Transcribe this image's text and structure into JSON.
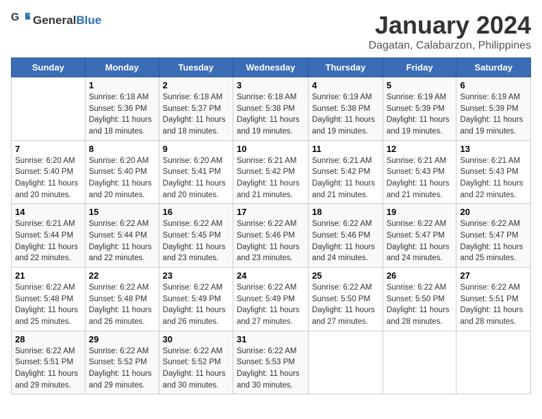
{
  "logo": {
    "general": "General",
    "blue": "Blue"
  },
  "title": "January 2024",
  "subtitle": "Dagatan, Calabarzon, Philippines",
  "days_of_week": [
    "Sunday",
    "Monday",
    "Tuesday",
    "Wednesday",
    "Thursday",
    "Friday",
    "Saturday"
  ],
  "weeks": [
    [
      {
        "day": "",
        "info": ""
      },
      {
        "day": "1",
        "info": "Sunrise: 6:18 AM\nSunset: 5:36 PM\nDaylight: 11 hours\nand 18 minutes."
      },
      {
        "day": "2",
        "info": "Sunrise: 6:18 AM\nSunset: 5:37 PM\nDaylight: 11 hours\nand 18 minutes."
      },
      {
        "day": "3",
        "info": "Sunrise: 6:18 AM\nSunset: 5:38 PM\nDaylight: 11 hours\nand 19 minutes."
      },
      {
        "day": "4",
        "info": "Sunrise: 6:19 AM\nSunset: 5:38 PM\nDaylight: 11 hours\nand 19 minutes."
      },
      {
        "day": "5",
        "info": "Sunrise: 6:19 AM\nSunset: 5:39 PM\nDaylight: 11 hours\nand 19 minutes."
      },
      {
        "day": "6",
        "info": "Sunrise: 6:19 AM\nSunset: 5:39 PM\nDaylight: 11 hours\nand 19 minutes."
      }
    ],
    [
      {
        "day": "7",
        "info": "Sunrise: 6:20 AM\nSunset: 5:40 PM\nDaylight: 11 hours\nand 20 minutes."
      },
      {
        "day": "8",
        "info": "Sunrise: 6:20 AM\nSunset: 5:40 PM\nDaylight: 11 hours\nand 20 minutes."
      },
      {
        "day": "9",
        "info": "Sunrise: 6:20 AM\nSunset: 5:41 PM\nDaylight: 11 hours\nand 20 minutes."
      },
      {
        "day": "10",
        "info": "Sunrise: 6:21 AM\nSunset: 5:42 PM\nDaylight: 11 hours\nand 21 minutes."
      },
      {
        "day": "11",
        "info": "Sunrise: 6:21 AM\nSunset: 5:42 PM\nDaylight: 11 hours\nand 21 minutes."
      },
      {
        "day": "12",
        "info": "Sunrise: 6:21 AM\nSunset: 5:43 PM\nDaylight: 11 hours\nand 21 minutes."
      },
      {
        "day": "13",
        "info": "Sunrise: 6:21 AM\nSunset: 5:43 PM\nDaylight: 11 hours\nand 22 minutes."
      }
    ],
    [
      {
        "day": "14",
        "info": "Sunrise: 6:21 AM\nSunset: 5:44 PM\nDaylight: 11 hours\nand 22 minutes."
      },
      {
        "day": "15",
        "info": "Sunrise: 6:22 AM\nSunset: 5:44 PM\nDaylight: 11 hours\nand 22 minutes."
      },
      {
        "day": "16",
        "info": "Sunrise: 6:22 AM\nSunset: 5:45 PM\nDaylight: 11 hours\nand 23 minutes."
      },
      {
        "day": "17",
        "info": "Sunrise: 6:22 AM\nSunset: 5:46 PM\nDaylight: 11 hours\nand 23 minutes."
      },
      {
        "day": "18",
        "info": "Sunrise: 6:22 AM\nSunset: 5:46 PM\nDaylight: 11 hours\nand 24 minutes."
      },
      {
        "day": "19",
        "info": "Sunrise: 6:22 AM\nSunset: 5:47 PM\nDaylight: 11 hours\nand 24 minutes."
      },
      {
        "day": "20",
        "info": "Sunrise: 6:22 AM\nSunset: 5:47 PM\nDaylight: 11 hours\nand 25 minutes."
      }
    ],
    [
      {
        "day": "21",
        "info": "Sunrise: 6:22 AM\nSunset: 5:48 PM\nDaylight: 11 hours\nand 25 minutes."
      },
      {
        "day": "22",
        "info": "Sunrise: 6:22 AM\nSunset: 5:48 PM\nDaylight: 11 hours\nand 26 minutes."
      },
      {
        "day": "23",
        "info": "Sunrise: 6:22 AM\nSunset: 5:49 PM\nDaylight: 11 hours\nand 26 minutes."
      },
      {
        "day": "24",
        "info": "Sunrise: 6:22 AM\nSunset: 5:49 PM\nDaylight: 11 hours\nand 27 minutes."
      },
      {
        "day": "25",
        "info": "Sunrise: 6:22 AM\nSunset: 5:50 PM\nDaylight: 11 hours\nand 27 minutes."
      },
      {
        "day": "26",
        "info": "Sunrise: 6:22 AM\nSunset: 5:50 PM\nDaylight: 11 hours\nand 28 minutes."
      },
      {
        "day": "27",
        "info": "Sunrise: 6:22 AM\nSunset: 5:51 PM\nDaylight: 11 hours\nand 28 minutes."
      }
    ],
    [
      {
        "day": "28",
        "info": "Sunrise: 6:22 AM\nSunset: 5:51 PM\nDaylight: 11 hours\nand 29 minutes."
      },
      {
        "day": "29",
        "info": "Sunrise: 6:22 AM\nSunset: 5:52 PM\nDaylight: 11 hours\nand 29 minutes."
      },
      {
        "day": "30",
        "info": "Sunrise: 6:22 AM\nSunset: 5:52 PM\nDaylight: 11 hours\nand 30 minutes."
      },
      {
        "day": "31",
        "info": "Sunrise: 6:22 AM\nSunset: 5:53 PM\nDaylight: 11 hours\nand 30 minutes."
      },
      {
        "day": "",
        "info": ""
      },
      {
        "day": "",
        "info": ""
      },
      {
        "day": "",
        "info": ""
      }
    ]
  ]
}
